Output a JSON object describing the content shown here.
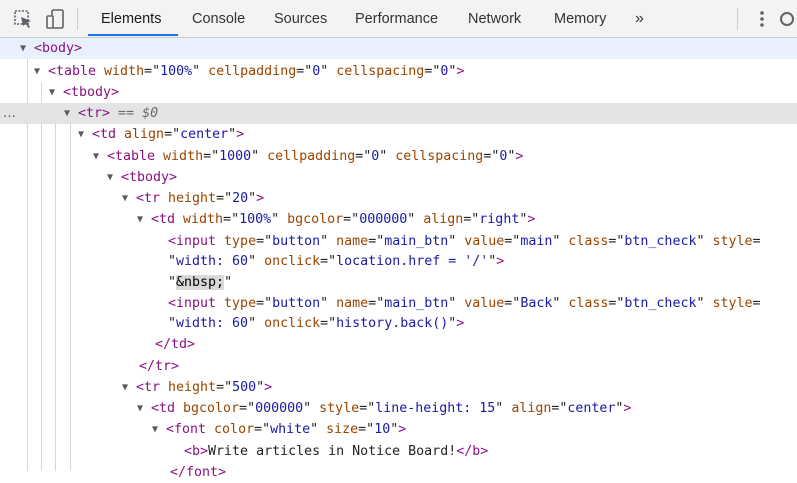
{
  "toolbar": {
    "tabs": [
      "Elements",
      "Console",
      "Sources",
      "Performance",
      "Network",
      "Memory"
    ],
    "active_tab": "Elements",
    "overflow": "»",
    "accent": "#1a73e8"
  },
  "colors": {
    "tag": "#881280",
    "attr_name": "#994500",
    "attr_value": "#1a1aa6",
    "selected_row": "#e4e4e4",
    "hover_row": "#e8f0fe"
  },
  "icons": [
    "inspect-element-icon",
    "device-toolbar-icon",
    "more-tabs-icon",
    "kebab-menu-icon",
    "settings-icon"
  ],
  "dom": {
    "selected_marker": "== $0",
    "ellipsis": "…",
    "lines": [
      {
        "parts": [
          [
            "t",
            "<body>"
          ]
        ]
      },
      {
        "parts": [
          [
            "t",
            "<table "
          ],
          [
            "n",
            "width"
          ],
          [
            "e",
            "=\""
          ],
          [
            "v",
            "100%"
          ],
          [
            "e",
            "\" "
          ],
          [
            "n",
            "cellpadding"
          ],
          [
            "e",
            "=\""
          ],
          [
            "v",
            "0"
          ],
          [
            "e",
            "\" "
          ],
          [
            "n",
            "cellspacing"
          ],
          [
            "e",
            "=\""
          ],
          [
            "v",
            "0"
          ],
          [
            "e",
            "\""
          ],
          [
            "t",
            ">"
          ]
        ]
      },
      {
        "parts": [
          [
            "t",
            "<tbody>"
          ]
        ]
      },
      {
        "parts": [
          [
            "t",
            "<tr>"
          ]
        ]
      },
      {
        "parts": [
          [
            "t",
            "<td "
          ],
          [
            "n",
            "align"
          ],
          [
            "e",
            "=\""
          ],
          [
            "v",
            "center"
          ],
          [
            "e",
            "\""
          ],
          [
            "t",
            ">"
          ]
        ]
      },
      {
        "parts": [
          [
            "t",
            "<table "
          ],
          [
            "n",
            "width"
          ],
          [
            "e",
            "=\""
          ],
          [
            "v",
            "1000"
          ],
          [
            "e",
            "\" "
          ],
          [
            "n",
            "cellpadding"
          ],
          [
            "e",
            "=\""
          ],
          [
            "v",
            "0"
          ],
          [
            "e",
            "\" "
          ],
          [
            "n",
            "cellspacing"
          ],
          [
            "e",
            "=\""
          ],
          [
            "v",
            "0"
          ],
          [
            "e",
            "\""
          ],
          [
            "t",
            ">"
          ]
        ]
      },
      {
        "parts": [
          [
            "t",
            "<tbody>"
          ]
        ]
      },
      {
        "parts": [
          [
            "t",
            "<tr "
          ],
          [
            "n",
            "height"
          ],
          [
            "e",
            "=\""
          ],
          [
            "v",
            "20"
          ],
          [
            "e",
            "\""
          ],
          [
            "t",
            ">"
          ]
        ]
      },
      {
        "parts": [
          [
            "t",
            "<td "
          ],
          [
            "n",
            "width"
          ],
          [
            "e",
            "=\""
          ],
          [
            "v",
            "100%"
          ],
          [
            "e",
            "\" "
          ],
          [
            "n",
            "bgcolor"
          ],
          [
            "e",
            "=\""
          ],
          [
            "v",
            "000000"
          ],
          [
            "e",
            "\" "
          ],
          [
            "n",
            "align"
          ],
          [
            "e",
            "=\""
          ],
          [
            "v",
            "right"
          ],
          [
            "e",
            "\""
          ],
          [
            "t",
            ">"
          ]
        ]
      },
      {
        "parts": [
          [
            "t",
            "<input "
          ],
          [
            "n",
            "type"
          ],
          [
            "e",
            "=\""
          ],
          [
            "v",
            "button"
          ],
          [
            "e",
            "\" "
          ],
          [
            "n",
            "name"
          ],
          [
            "e",
            "=\""
          ],
          [
            "v",
            "main_btn"
          ],
          [
            "e",
            "\" "
          ],
          [
            "n",
            "value"
          ],
          [
            "e",
            "=\""
          ],
          [
            "v",
            "main"
          ],
          [
            "e",
            "\" "
          ],
          [
            "n",
            "class"
          ],
          [
            "e",
            "=\""
          ],
          [
            "v",
            "btn_check"
          ],
          [
            "e",
            "\" "
          ],
          [
            "n",
            "style"
          ],
          [
            "e",
            "="
          ]
        ]
      },
      {
        "parts": [
          [
            "e",
            "\""
          ],
          [
            "v",
            "width: 60"
          ],
          [
            "e",
            "\" "
          ],
          [
            "n",
            "onclick"
          ],
          [
            "e",
            "=\""
          ],
          [
            "v",
            "location.href = '/'"
          ],
          [
            "e",
            "\""
          ],
          [
            "t",
            ">"
          ]
        ]
      },
      {
        "parts": [
          [
            "x",
            "\""
          ],
          [
            "m",
            "&nbsp;"
          ],
          [
            "x",
            "\""
          ]
        ]
      },
      {
        "parts": [
          [
            "t",
            "<input "
          ],
          [
            "n",
            "type"
          ],
          [
            "e",
            "=\""
          ],
          [
            "v",
            "button"
          ],
          [
            "e",
            "\" "
          ],
          [
            "n",
            "name"
          ],
          [
            "e",
            "=\""
          ],
          [
            "v",
            "main_btn"
          ],
          [
            "e",
            "\" "
          ],
          [
            "n",
            "value"
          ],
          [
            "e",
            "=\""
          ],
          [
            "v",
            "Back"
          ],
          [
            "e",
            "\" "
          ],
          [
            "n",
            "class"
          ],
          [
            "e",
            "=\""
          ],
          [
            "v",
            "btn_check"
          ],
          [
            "e",
            "\" "
          ],
          [
            "n",
            "style"
          ],
          [
            "e",
            "="
          ]
        ]
      },
      {
        "parts": [
          [
            "e",
            "\""
          ],
          [
            "v",
            "width: 60"
          ],
          [
            "e",
            "\" "
          ],
          [
            "n",
            "onclick"
          ],
          [
            "e",
            "=\""
          ],
          [
            "v",
            "history.back()"
          ],
          [
            "e",
            "\""
          ],
          [
            "t",
            ">"
          ]
        ]
      },
      {
        "parts": [
          [
            "t",
            "</td>"
          ]
        ]
      },
      {
        "parts": [
          [
            "t",
            "</tr>"
          ]
        ]
      },
      {
        "parts": [
          [
            "t",
            "<tr "
          ],
          [
            "n",
            "height"
          ],
          [
            "e",
            "=\""
          ],
          [
            "v",
            "500"
          ],
          [
            "e",
            "\""
          ],
          [
            "t",
            ">"
          ]
        ]
      },
      {
        "parts": [
          [
            "t",
            "<td "
          ],
          [
            "n",
            "bgcolor"
          ],
          [
            "e",
            "=\""
          ],
          [
            "v",
            "000000"
          ],
          [
            "e",
            "\" "
          ],
          [
            "n",
            "style"
          ],
          [
            "e",
            "=\""
          ],
          [
            "v",
            "line-height: 15"
          ],
          [
            "e",
            "\" "
          ],
          [
            "n",
            "align"
          ],
          [
            "e",
            "=\""
          ],
          [
            "v",
            "center"
          ],
          [
            "e",
            "\""
          ],
          [
            "t",
            ">"
          ]
        ]
      },
      {
        "parts": [
          [
            "t",
            "<font "
          ],
          [
            "n",
            "color"
          ],
          [
            "e",
            "=\""
          ],
          [
            "v",
            "white"
          ],
          [
            "e",
            "\" "
          ],
          [
            "n",
            "size"
          ],
          [
            "e",
            "=\""
          ],
          [
            "v",
            "10"
          ],
          [
            "e",
            "\""
          ],
          [
            "t",
            ">"
          ]
        ]
      },
      {
        "parts": [
          [
            "t",
            "<b>"
          ],
          [
            "x",
            "Write articles in Notice Board!"
          ],
          [
            "t",
            "</b>"
          ]
        ]
      },
      {
        "parts": [
          [
            "t",
            "</font>"
          ]
        ]
      }
    ]
  }
}
